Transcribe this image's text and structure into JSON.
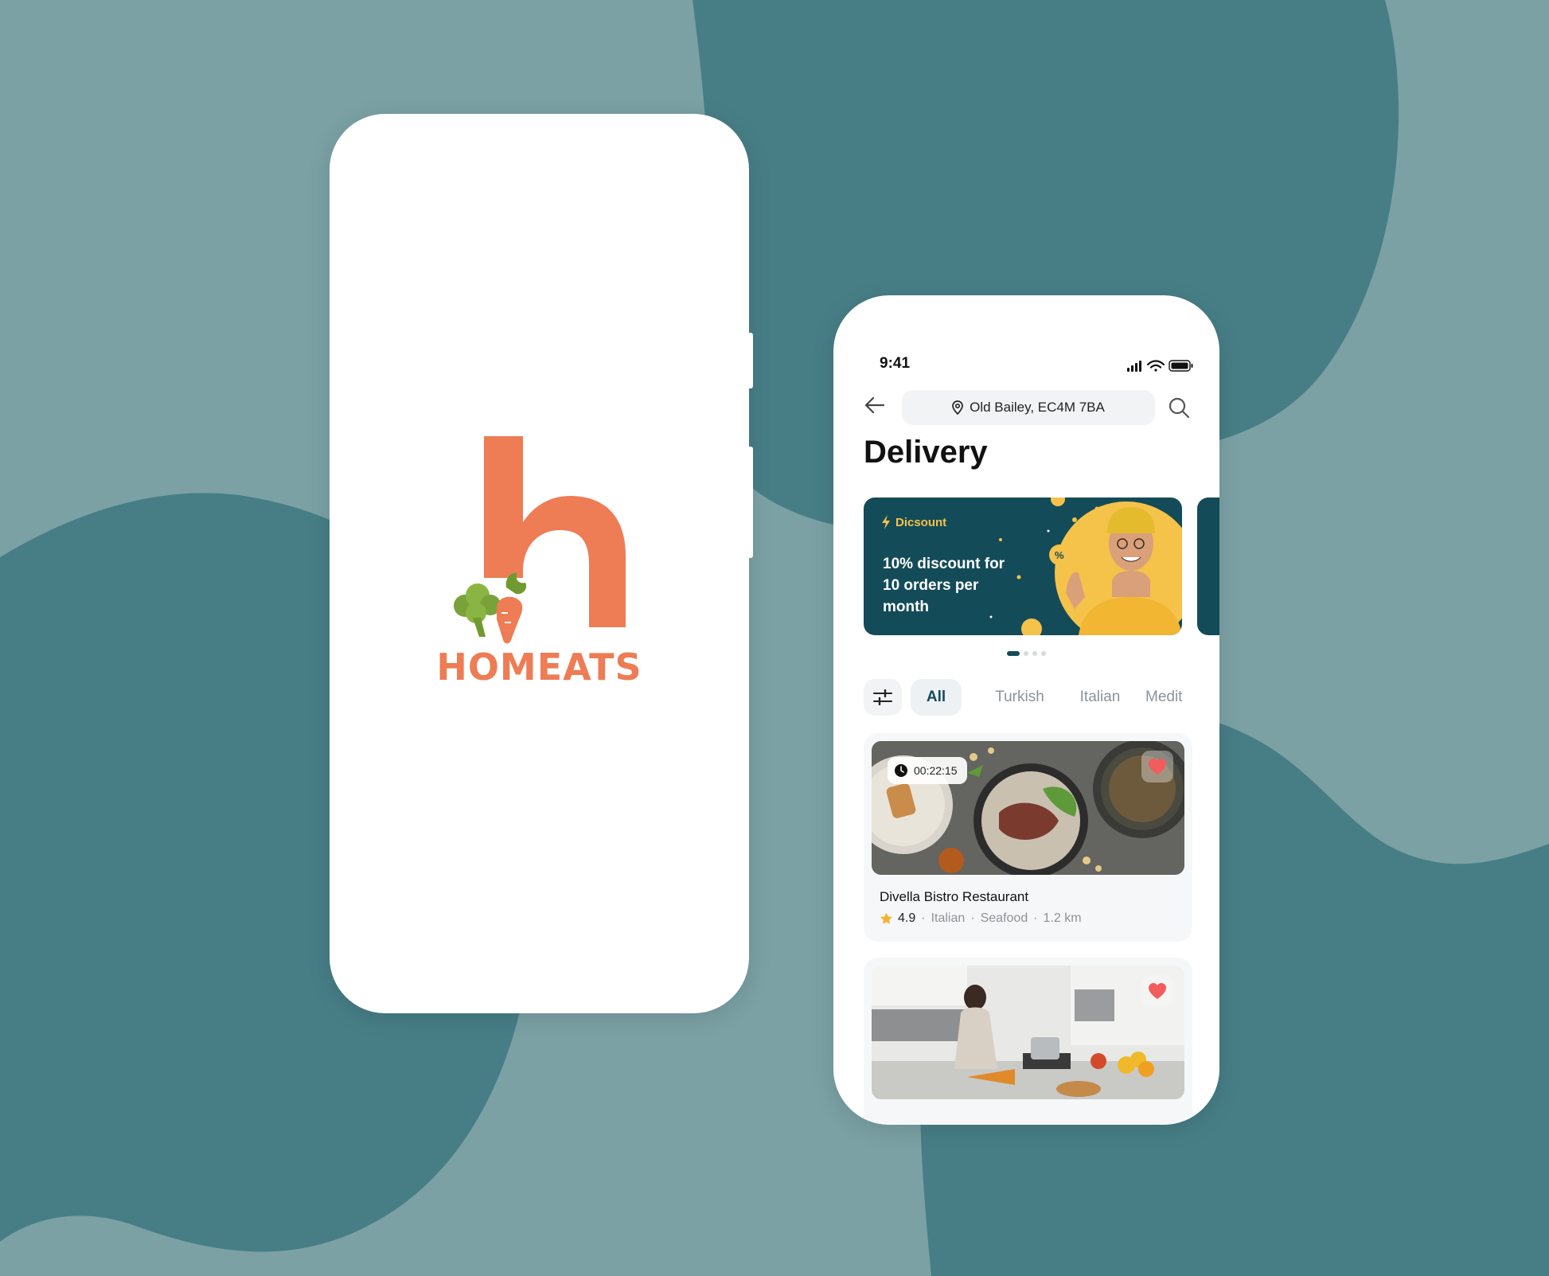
{
  "colors": {
    "background": "#7ba1a5",
    "blob": "#477e86",
    "brand": "#ee7c55",
    "accent_dark": "#144b58",
    "accent_yellow": "#f5c24a"
  },
  "splash": {
    "brand_name": "HOMEATS",
    "logo_icons": [
      "h-letter-logo",
      "broccoli-icon",
      "carrot-icon"
    ]
  },
  "app": {
    "status_bar": {
      "time": "9:41",
      "icons": [
        "signal-icon",
        "wifi-icon",
        "battery-icon"
      ]
    },
    "header": {
      "location": "Old Bailey, EC4M 7BA",
      "icons": [
        "back-arrow-icon",
        "location-pin-icon",
        "search-icon"
      ]
    },
    "title": "Delivery",
    "banner": {
      "tag": "Dicsount",
      "text": "10% discount for 10 orders per month",
      "carousel": {
        "count": 4,
        "active": 1
      }
    },
    "categories": [
      "All",
      "Turkish",
      "Italian",
      "Medit"
    ],
    "selected_category": "All",
    "restaurants": [
      {
        "name": "Divella Bistro Restaurant",
        "timer": "00:22:15",
        "rating": "4.9",
        "cuisine": "Italian",
        "tag": "Seafood",
        "distance": "1.2 km",
        "favorite": true
      },
      {
        "favorite": true
      }
    ]
  }
}
